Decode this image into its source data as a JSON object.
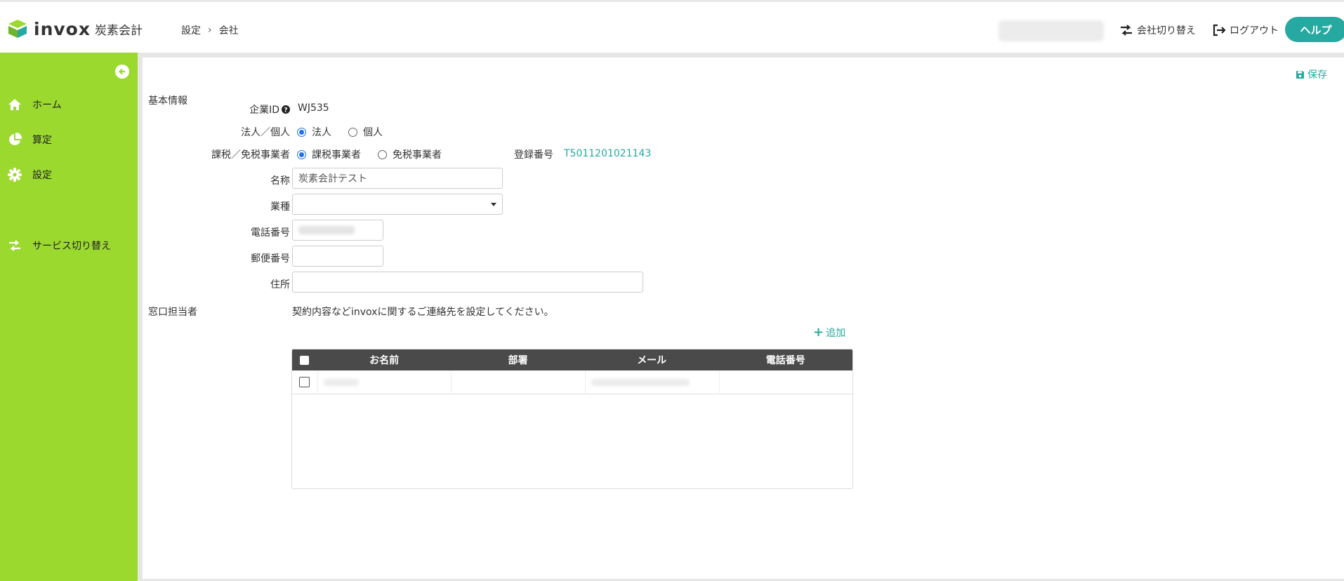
{
  "header": {
    "logo_text": "invox",
    "logo_sub": "炭素会計",
    "breadcrumb": [
      "設定",
      "会社"
    ],
    "breadcrumb_sep": "›",
    "switch_company": "会社切り替え",
    "logout": "ログアウト",
    "help": "ヘルプ"
  },
  "sidebar": {
    "items": [
      {
        "label": "ホーム",
        "icon": "home-icon"
      },
      {
        "label": "算定",
        "icon": "pie-chart-icon"
      },
      {
        "label": "設定",
        "icon": "gear-icon"
      },
      {
        "label": "サービス切り替え",
        "icon": "switch-arrows-icon"
      }
    ]
  },
  "main": {
    "save": "保存",
    "basic_info": {
      "title": "基本情報",
      "company_id_label": "企業ID",
      "company_id_value": "WJ535",
      "entity_label": "法人／個人",
      "entity_options": [
        "法人",
        "個人"
      ],
      "entity_selected": "法人",
      "tax_label": "課税／免税事業者",
      "tax_options": [
        "課税事業者",
        "免税事業者"
      ],
      "tax_selected": "課税事業者",
      "reg_label": "登録番号",
      "reg_value": "T5011201021143",
      "name_label": "名称",
      "name_value": "炭素会計テスト",
      "industry_label": "業種",
      "industry_value": "",
      "phone_label": "電話番号",
      "postal_label": "郵便番号",
      "postal_value": "",
      "address_label": "住所",
      "address_value": ""
    },
    "contact": {
      "title": "窓口担当者",
      "note": "契約内容などinvoxに関するご連絡先を設定してください。",
      "add": "追加",
      "columns": [
        "お名前",
        "部署",
        "メール",
        "電話番号"
      ]
    }
  },
  "colors": {
    "accent": "#26a9a0",
    "sidebar": "#9bd92f",
    "table_header": "#4a4a4a"
  }
}
